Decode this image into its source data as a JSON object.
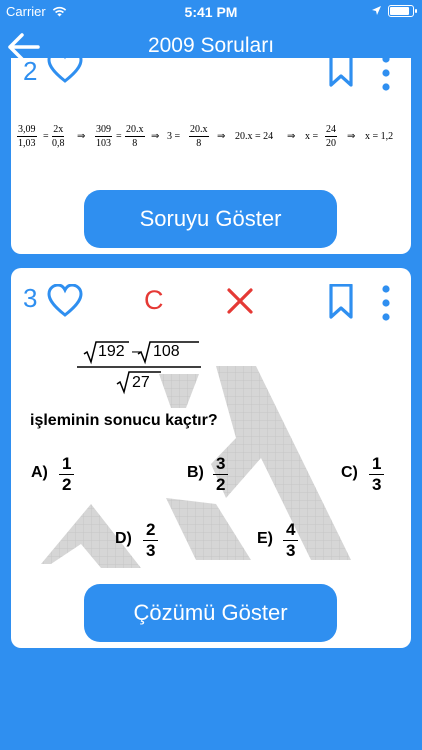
{
  "status": {
    "carrier": "Carrier",
    "time": "5:41 PM"
  },
  "nav": {
    "title": "2009 Soruları"
  },
  "card1": {
    "number": "2",
    "formula": {
      "f1n": "3,09",
      "f1d": "1,03",
      "eq1": "=",
      "f2n": "2x",
      "f2d": "0,8",
      "arr1": "⇒",
      "f3n": "309",
      "f3d": "103",
      "eq2": "=",
      "f4n": "20.x",
      "f4d": "8",
      "arr2": "⇒",
      "t3": "3 =",
      "f5n": "20.x",
      "f5d": "8",
      "arr3": "⇒",
      "t4": "20.x = 24",
      "arr4": "⇒",
      "t5": "x =",
      "f6n": "24",
      "f6d": "20",
      "arr5": "⇒",
      "t6": "x = 1,2"
    },
    "button": "Soruyu Göster"
  },
  "card2": {
    "number": "3",
    "answer_letter": "C",
    "colors": {
      "answer": "#e53935",
      "wrong_mark": "#e53935",
      "accent": "#2f8ff0"
    },
    "expr": {
      "rad1": "192",
      "minus": "–",
      "rad2": "108",
      "rad3": "27"
    },
    "question": "işleminin sonucu kaçtır?",
    "choices": [
      {
        "label": "A)",
        "num": "1",
        "den": "2"
      },
      {
        "label": "B)",
        "num": "3",
        "den": "2"
      },
      {
        "label": "C)",
        "num": "1",
        "den": "3"
      },
      {
        "label": "D)",
        "num": "2",
        "den": "3"
      },
      {
        "label": "E)",
        "num": "4",
        "den": "3"
      }
    ],
    "button": "Çözümü Göster"
  }
}
